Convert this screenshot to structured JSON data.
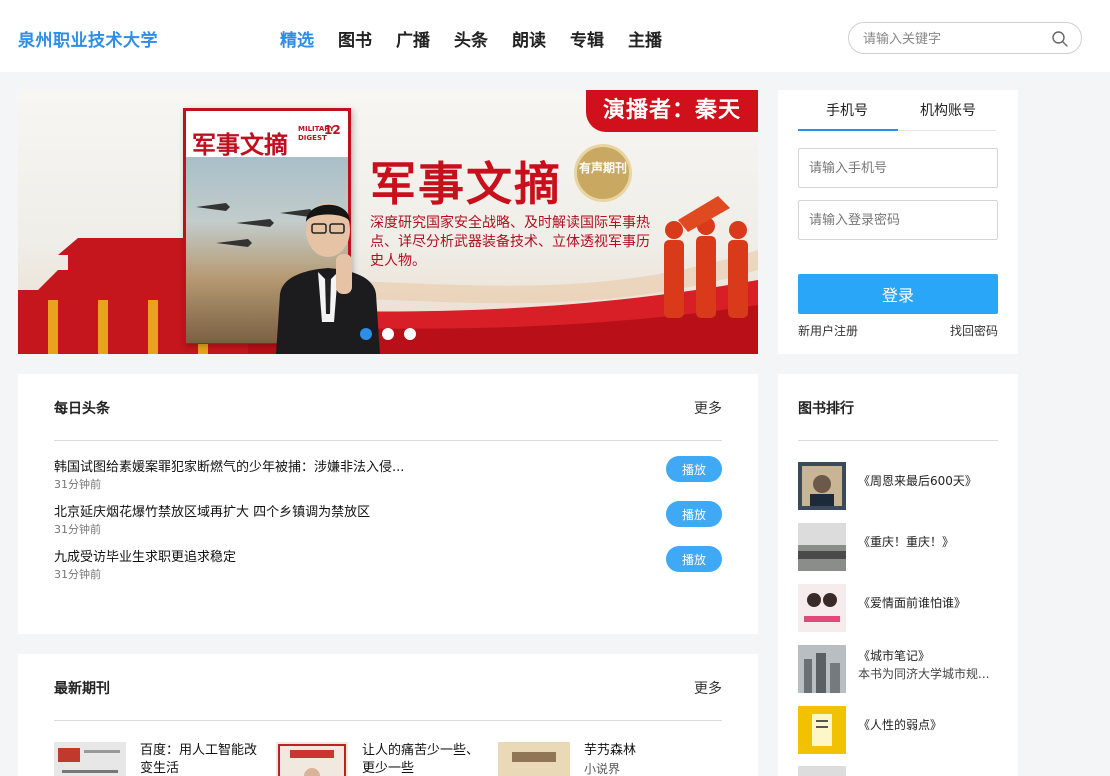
{
  "header": {
    "logo": "泉州职业技术大学",
    "nav": [
      "精选",
      "图书",
      "广播",
      "头条",
      "朗读",
      "专辑",
      "主播"
    ],
    "active_nav": "精选",
    "search_placeholder": "请输入关键字"
  },
  "banner": {
    "presenter": "演播者：秦天",
    "magazine_title": "军事文摘",
    "magazine_sub": "MILITARY DIGEST",
    "magazine_issue": "12",
    "big_title": "军事文摘",
    "badge": "有声期刊",
    "tagline": "深度研究国家安全战略、及时解读国际军事热点、详尽分析武器装备技术、立体透视军事历史人物。",
    "dots": 3,
    "active_dot": 0
  },
  "login": {
    "tab_phone": "手机号",
    "tab_org": "机构账号",
    "phone_placeholder": "请输入手机号",
    "password_placeholder": "请输入登录密码",
    "login_button": "登录",
    "register": "新用户注册",
    "forgot": "找回密码"
  },
  "daily_news": {
    "title": "每日头条",
    "more": "更多",
    "play_label": "播放",
    "items": [
      {
        "title": "韩国试图给素媛案罪犯家断燃气的少年被捕：涉嫌非法入侵...",
        "time": "31分钟前"
      },
      {
        "title": "北京延庆烟花爆竹禁放区域再扩大 四个乡镇调为禁放区",
        "time": "31分钟前"
      },
      {
        "title": "九成受访毕业生求职更追求稳定",
        "time": "31分钟前"
      }
    ]
  },
  "book_ranking": {
    "title": "图书排行",
    "items": [
      {
        "title": "《周恩来最后600天》",
        "desc": ""
      },
      {
        "title": "《重庆！重庆！》",
        "desc": ""
      },
      {
        "title": "《爱情面前谁怕谁》",
        "desc": ""
      },
      {
        "title": "《城市笔记》",
        "desc": "本书为同济大学城市规..."
      },
      {
        "title": "《人性的弱点》",
        "desc": ""
      }
    ],
    "cover_colors": [
      "#3a4a5a",
      "#8a8d8a",
      "#e9d4d6",
      "#9aa1a4",
      "#f2c200"
    ]
  },
  "latest_issues": {
    "title": "最新期刊",
    "more": "更多",
    "items": [
      {
        "title": "百度：用人工智能改变生活",
        "sub": ""
      },
      {
        "title": "让人的痛苦少一些、更少一些",
        "sub": ""
      },
      {
        "title": "芋艿森林",
        "sub": "小说界"
      }
    ],
    "cover_colors": [
      "#e7e7e7",
      "#f1e9df",
      "#e9d9b7"
    ]
  },
  "colors": {
    "accent": "#2d8ee8",
    "button": "#2aa6f8",
    "play": "#3fa9f5",
    "banner_red": "#d0101b"
  }
}
